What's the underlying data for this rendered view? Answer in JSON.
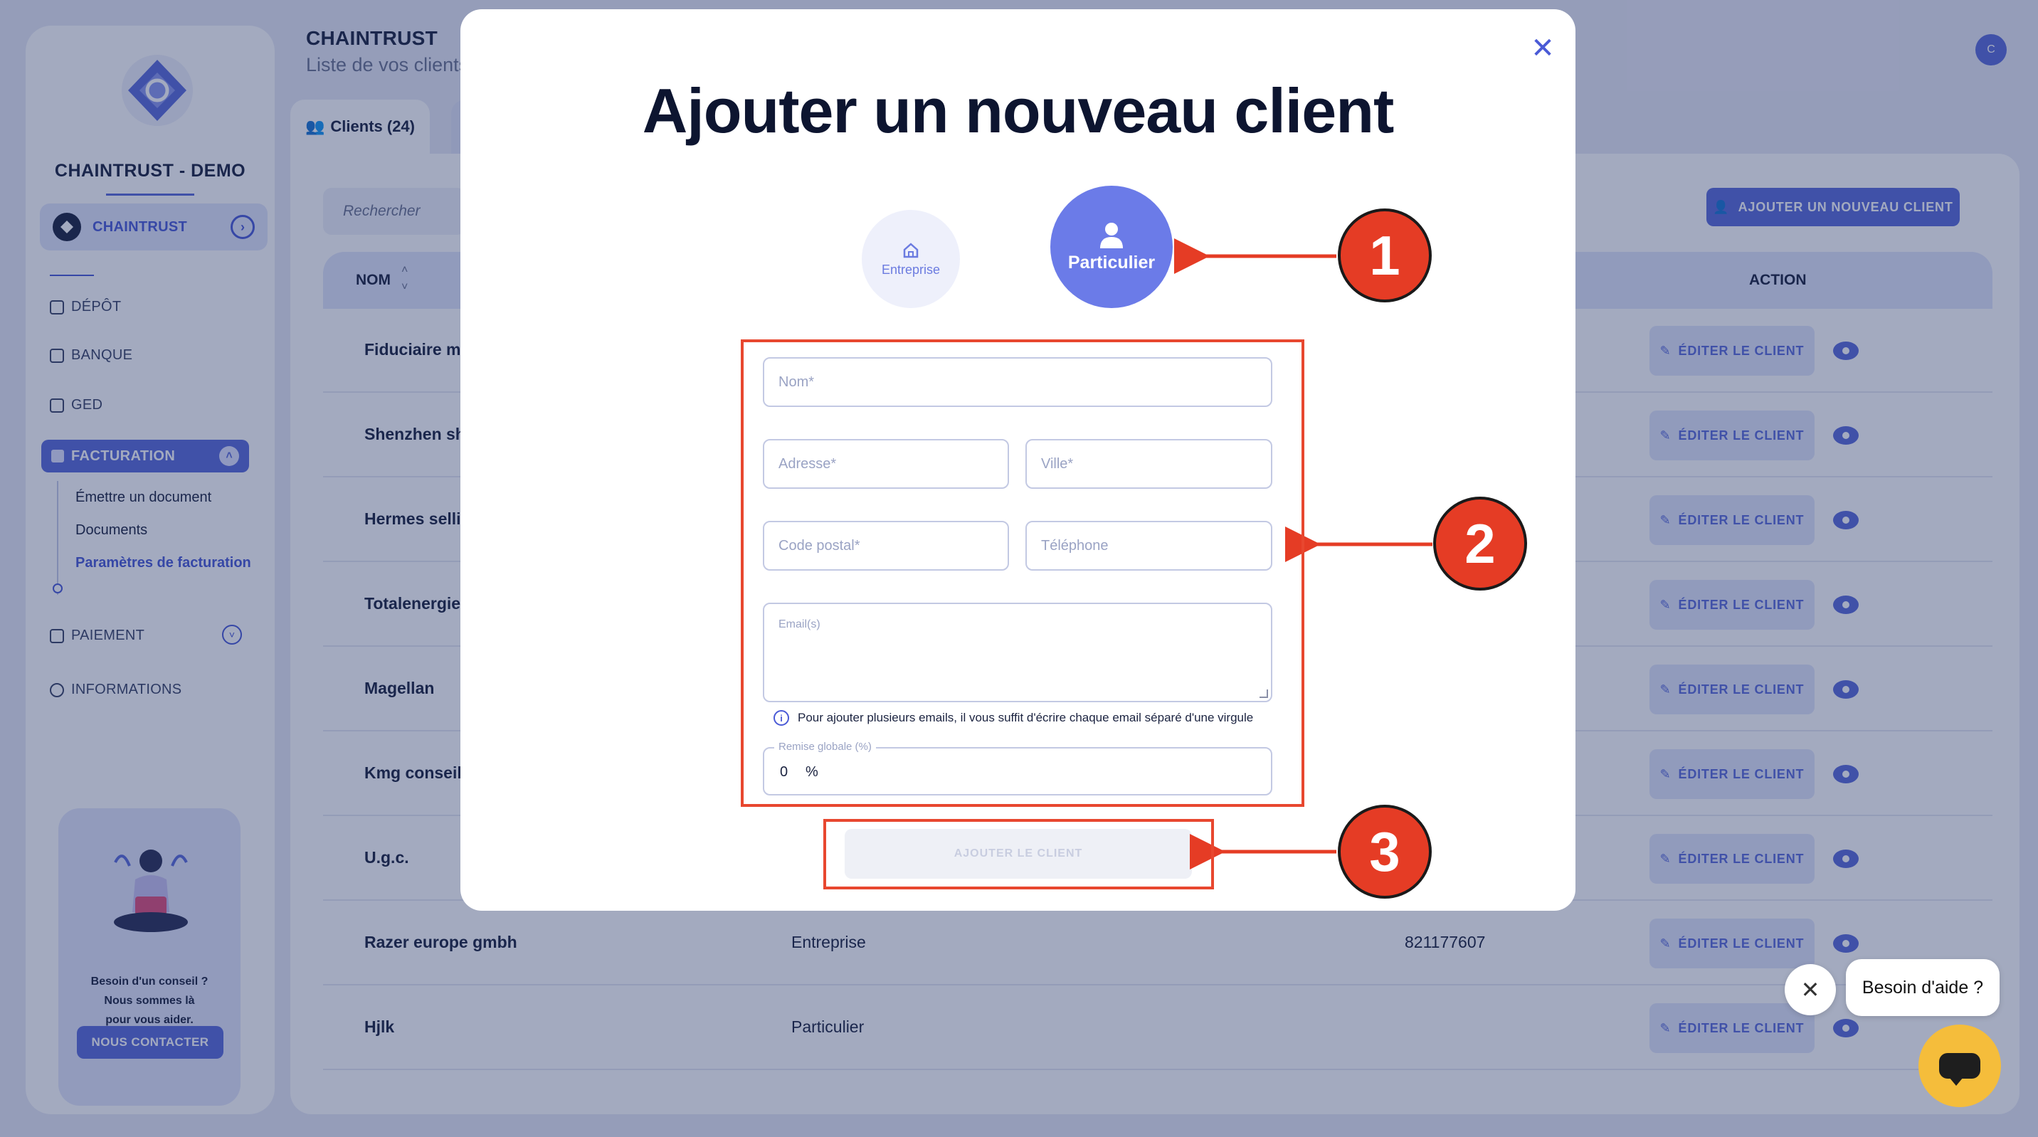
{
  "app": {
    "brand": "CHAINTRUST - DEMO",
    "page_title": "CHAINTRUST",
    "page_subtitle": "Liste de vos clients",
    "avatar_letter": "C",
    "accent_color": "#5b6cd9"
  },
  "sidebar": {
    "company": "CHAINTRUST",
    "items": [
      {
        "label": "DÉPÔT",
        "icon": "upload-icon"
      },
      {
        "label": "BANQUE",
        "icon": "bank-icon"
      },
      {
        "label": "GED",
        "icon": "document-icon"
      },
      {
        "label": "FACTURATION",
        "icon": "invoice-icon"
      },
      {
        "label": "PAIEMENT",
        "icon": "card-icon"
      },
      {
        "label": "INFORMATIONS",
        "icon": "info-icon"
      }
    ],
    "sub_items": [
      "Émettre un document",
      "Documents",
      "Paramètres de facturation"
    ],
    "help": {
      "line1": "Besoin d'un conseil ?",
      "line2": "Nous sommes là",
      "line3": "pour vous aider.",
      "button": "NOUS CONTACTER"
    }
  },
  "main": {
    "tab_clients": "Clients (24)",
    "search_placeholder": "Rechercher",
    "add_button": "AJOUTER UN NOUVEAU CLIENT",
    "columns": {
      "name": "NOM",
      "action": "ACTION"
    },
    "edit_label": "ÉDITER LE CLIENT",
    "rows": [
      {
        "name": "Fiduciaire mo",
        "type": "",
        "siren": ""
      },
      {
        "name": "Shenzhen shi",
        "type": "",
        "siren": ""
      },
      {
        "name": "Hermes sellie",
        "type": "",
        "siren": ""
      },
      {
        "name": "Totalenergies",
        "type": "",
        "siren": ""
      },
      {
        "name": "Magellan",
        "type": "",
        "siren": ""
      },
      {
        "name": "Kmg conseil",
        "type": "",
        "siren": ""
      },
      {
        "name": "U.g.c.",
        "type": "",
        "siren": ""
      },
      {
        "name": "Razer europe gmbh",
        "type": "Entreprise",
        "siren": "821177607"
      },
      {
        "name": "Hjlk",
        "type": "Particulier",
        "siren": ""
      }
    ]
  },
  "modal": {
    "title": "Ajouter un nouveau client",
    "close": "✕",
    "type_company": "Entreprise",
    "type_person": "Particulier",
    "fields": {
      "nom": "Nom*",
      "adresse": "Adresse*",
      "ville": "Ville*",
      "code_postal": "Code postal*",
      "telephone": "Téléphone",
      "emails": "Email(s)"
    },
    "email_hint": "Pour ajouter plusieurs emails, il vous suffit d'écrire chaque email séparé d'une virgule",
    "remise_label": "Remise globale (%)",
    "remise_value": "0",
    "remise_unit": "%",
    "submit": "AJOUTER LE CLIENT"
  },
  "annotations": {
    "m1": "1",
    "m2": "2",
    "m3": "3",
    "color": "#e53c25"
  },
  "chat": {
    "close": "✕",
    "bubble": "Besoin d'aide ?"
  }
}
